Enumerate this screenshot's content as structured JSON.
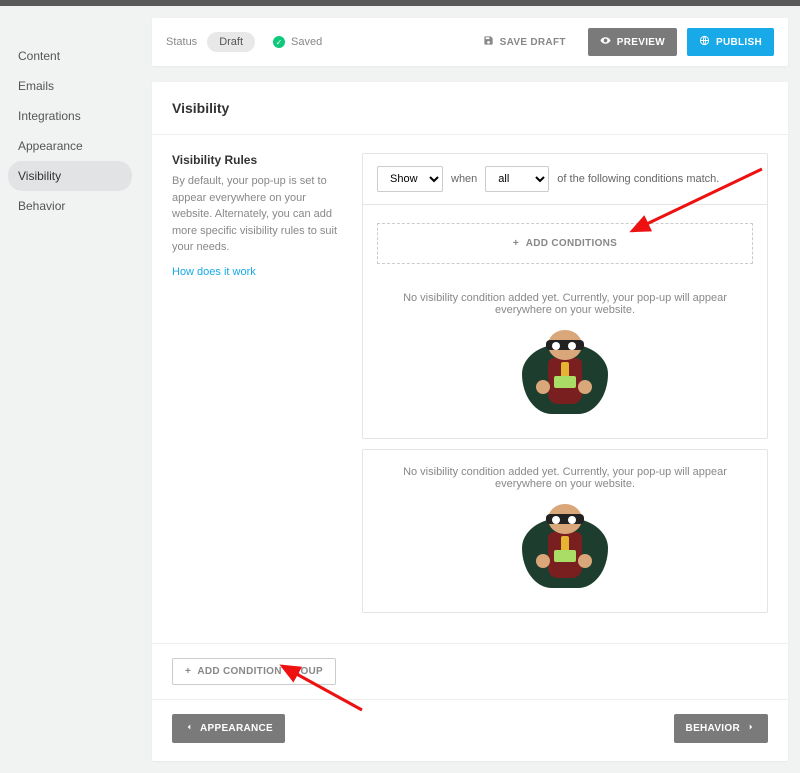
{
  "sidebar": {
    "items": [
      {
        "label": "Content"
      },
      {
        "label": "Emails"
      },
      {
        "label": "Integrations"
      },
      {
        "label": "Appearance"
      },
      {
        "label": "Visibility"
      },
      {
        "label": "Behavior"
      }
    ]
  },
  "statusbar": {
    "status_label": "Status",
    "draft_label": "Draft",
    "saved_label": "Saved",
    "save_draft": "SAVE DRAFT",
    "preview": "PREVIEW",
    "publish": "PUBLISH"
  },
  "panel": {
    "title": "Visibility",
    "rules_title": "Visibility Rules",
    "rules_desc": "By default, your pop-up is set to appear everywhere on your website. Alternately, you can add more specific visibility rules to suit your needs.",
    "how_link": "How does it work",
    "rule": {
      "show_option": "Show",
      "when_label": "when",
      "all_option": "all",
      "tail_label": "of the following conditions match."
    },
    "add_conditions": "ADD CONDITIONS",
    "empty_msg": "No visibility condition added yet. Currently, your pop-up will appear everywhere on your website.",
    "add_group": "ADD CONDITION GROUP"
  },
  "nav": {
    "prev": "APPEARANCE",
    "next": "BEHAVIOR"
  }
}
